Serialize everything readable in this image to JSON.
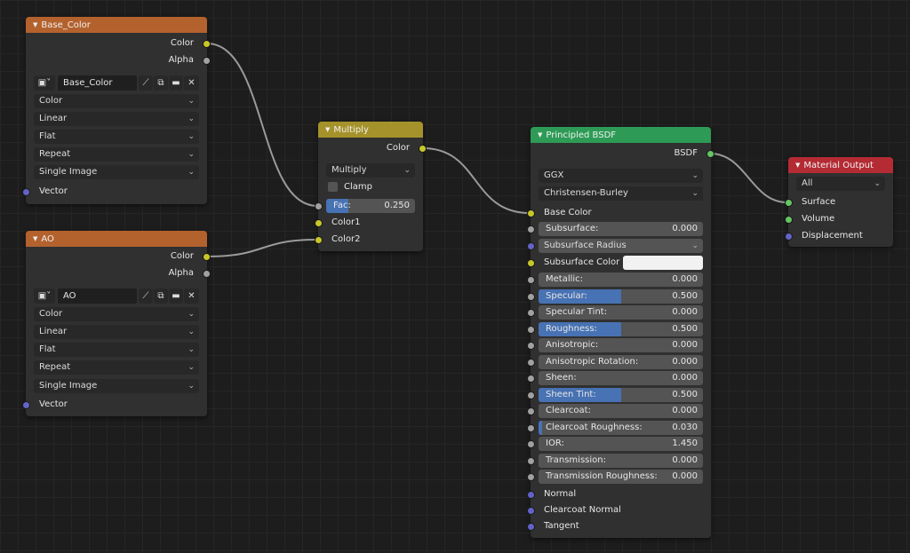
{
  "nodes": {
    "base_color": {
      "title": "Base_Color",
      "outputs": [
        "Color",
        "Alpha"
      ],
      "image_name": "Base_Color",
      "dropdowns": [
        "Color",
        "Linear",
        "Flat",
        "Repeat",
        "Single Image"
      ],
      "input": "Vector"
    },
    "ao": {
      "title": "AO",
      "outputs": [
        "Color",
        "Alpha"
      ],
      "image_name": "AO",
      "dropdowns": [
        "Color",
        "Linear",
        "Flat",
        "Repeat",
        "Single Image"
      ],
      "input": "Vector"
    },
    "multiply": {
      "title": "Multiply",
      "output": "Color",
      "blend_mode": "Multiply",
      "clamp_label": "Clamp",
      "fac_label": "Fac:",
      "fac_value": "0.250",
      "fac_fraction": 0.25,
      "inputs": [
        "Color1",
        "Color2"
      ]
    },
    "principled": {
      "title": "Principled BSDF",
      "output": "BSDF",
      "distribution": "GGX",
      "subsurface_method": "Christensen-Burley",
      "base_color_label": "Base Color",
      "subsurface_label": "Subsurface:",
      "subsurface_value": "0.000",
      "subsurface_radius_label": "Subsurface Radius",
      "subsurface_color_label": "Subsurface Color",
      "params": [
        {
          "label": "Metallic:",
          "value": "0.000",
          "fraction": 0
        },
        {
          "label": "Specular:",
          "value": "0.500",
          "fraction": 0.5
        },
        {
          "label": "Specular Tint:",
          "value": "0.000",
          "fraction": 0
        },
        {
          "label": "Roughness:",
          "value": "0.500",
          "fraction": 0.5
        },
        {
          "label": "Anisotropic:",
          "value": "0.000",
          "fraction": 0
        },
        {
          "label": "Anisotropic Rotation:",
          "value": "0.000",
          "fraction": 0
        },
        {
          "label": "Sheen:",
          "value": "0.000",
          "fraction": 0
        },
        {
          "label": "Sheen Tint:",
          "value": "0.500",
          "fraction": 0.5
        },
        {
          "label": "Clearcoat:",
          "value": "0.000",
          "fraction": 0
        },
        {
          "label": "Clearcoat Roughness:",
          "value": "0.030",
          "fraction": 0.03
        },
        {
          "label": "IOR:",
          "value": "1.450",
          "fraction": 0
        },
        {
          "label": "Transmission:",
          "value": "0.000",
          "fraction": 0
        },
        {
          "label": "Transmission Roughness:",
          "value": "0.000",
          "fraction": 0
        }
      ],
      "vector_inputs": [
        "Normal",
        "Clearcoat Normal",
        "Tangent"
      ]
    },
    "material_output": {
      "title": "Material Output",
      "target": "All",
      "inputs": [
        "Surface",
        "Volume",
        "Displacement"
      ]
    }
  },
  "colors": {
    "texture_header": "#b4622d",
    "mix_header": "#a5922a",
    "shader_header": "#2d9b55",
    "output_header": "#b42b34",
    "slider_fill": "#4772b3",
    "wire": "#9a9a9a"
  },
  "icons": [
    "image-icon",
    "browse-image-icon",
    "new-image-icon",
    "open-folder-icon",
    "unlink-icon",
    "chevron-down-icon"
  ]
}
